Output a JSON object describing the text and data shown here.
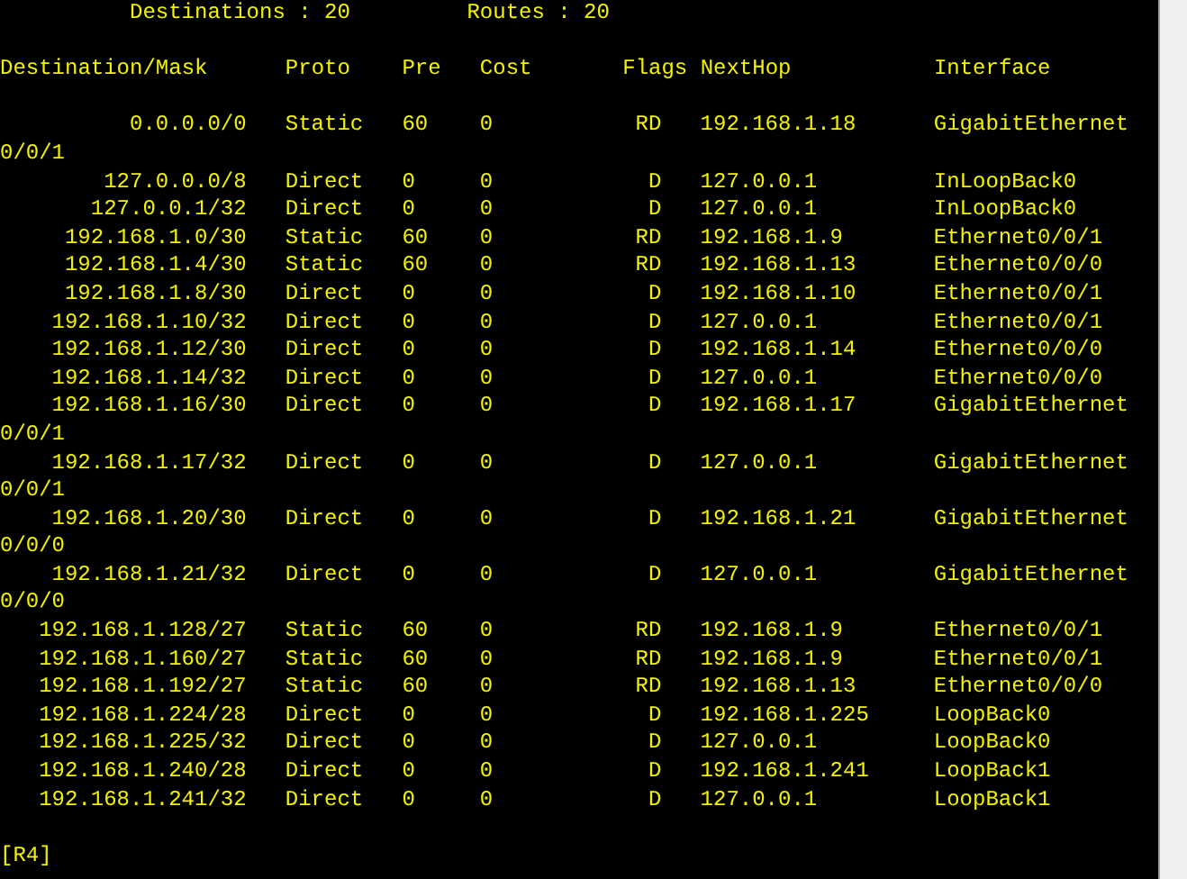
{
  "summary": {
    "destinations_label": "Destinations : 20",
    "routes_label": "Routes : 20"
  },
  "columns": [
    "Destination/Mask",
    "Proto",
    "Pre",
    "Cost",
    "Flags",
    "NextHop",
    "Interface"
  ],
  "routes": [
    {
      "destination": "0.0.0.0/0",
      "proto": "Static",
      "pre": "60",
      "cost": "0",
      "flags": "RD",
      "nexthop": "192.168.1.18",
      "interface": "GigabitEthernet",
      "interface_wrap": "0/0/1"
    },
    {
      "destination": "127.0.0.0/8",
      "proto": "Direct",
      "pre": "0",
      "cost": "0",
      "flags": "D",
      "nexthop": "127.0.0.1",
      "interface": "InLoopBack0"
    },
    {
      "destination": "127.0.0.1/32",
      "proto": "Direct",
      "pre": "0",
      "cost": "0",
      "flags": "D",
      "nexthop": "127.0.0.1",
      "interface": "InLoopBack0"
    },
    {
      "destination": "192.168.1.0/30",
      "proto": "Static",
      "pre": "60",
      "cost": "0",
      "flags": "RD",
      "nexthop": "192.168.1.9",
      "interface": "Ethernet0/0/1"
    },
    {
      "destination": "192.168.1.4/30",
      "proto": "Static",
      "pre": "60",
      "cost": "0",
      "flags": "RD",
      "nexthop": "192.168.1.13",
      "interface": "Ethernet0/0/0"
    },
    {
      "destination": "192.168.1.8/30",
      "proto": "Direct",
      "pre": "0",
      "cost": "0",
      "flags": "D",
      "nexthop": "192.168.1.10",
      "interface": "Ethernet0/0/1"
    },
    {
      "destination": "192.168.1.10/32",
      "proto": "Direct",
      "pre": "0",
      "cost": "0",
      "flags": "D",
      "nexthop": "127.0.0.1",
      "interface": "Ethernet0/0/1"
    },
    {
      "destination": "192.168.1.12/30",
      "proto": "Direct",
      "pre": "0",
      "cost": "0",
      "flags": "D",
      "nexthop": "192.168.1.14",
      "interface": "Ethernet0/0/0"
    },
    {
      "destination": "192.168.1.14/32",
      "proto": "Direct",
      "pre": "0",
      "cost": "0",
      "flags": "D",
      "nexthop": "127.0.0.1",
      "interface": "Ethernet0/0/0"
    },
    {
      "destination": "192.168.1.16/30",
      "proto": "Direct",
      "pre": "0",
      "cost": "0",
      "flags": "D",
      "nexthop": "192.168.1.17",
      "interface": "GigabitEthernet",
      "interface_wrap": "0/0/1"
    },
    {
      "destination": "192.168.1.17/32",
      "proto": "Direct",
      "pre": "0",
      "cost": "0",
      "flags": "D",
      "nexthop": "127.0.0.1",
      "interface": "GigabitEthernet",
      "interface_wrap": "0/0/1"
    },
    {
      "destination": "192.168.1.20/30",
      "proto": "Direct",
      "pre": "0",
      "cost": "0",
      "flags": "D",
      "nexthop": "192.168.1.21",
      "interface": "GigabitEthernet",
      "interface_wrap": "0/0/0"
    },
    {
      "destination": "192.168.1.21/32",
      "proto": "Direct",
      "pre": "0",
      "cost": "0",
      "flags": "D",
      "nexthop": "127.0.0.1",
      "interface": "GigabitEthernet",
      "interface_wrap": "0/0/0"
    },
    {
      "destination": "192.168.1.128/27",
      "proto": "Static",
      "pre": "60",
      "cost": "0",
      "flags": "RD",
      "nexthop": "192.168.1.9",
      "interface": "Ethernet0/0/1"
    },
    {
      "destination": "192.168.1.160/27",
      "proto": "Static",
      "pre": "60",
      "cost": "0",
      "flags": "RD",
      "nexthop": "192.168.1.9",
      "interface": "Ethernet0/0/1"
    },
    {
      "destination": "192.168.1.192/27",
      "proto": "Static",
      "pre": "60",
      "cost": "0",
      "flags": "RD",
      "nexthop": "192.168.1.13",
      "interface": "Ethernet0/0/0"
    },
    {
      "destination": "192.168.1.224/28",
      "proto": "Direct",
      "pre": "0",
      "cost": "0",
      "flags": "D",
      "nexthop": "192.168.1.225",
      "interface": "LoopBack0"
    },
    {
      "destination": "192.168.1.225/32",
      "proto": "Direct",
      "pre": "0",
      "cost": "0",
      "flags": "D",
      "nexthop": "127.0.0.1",
      "interface": "LoopBack0"
    },
    {
      "destination": "192.168.1.240/28",
      "proto": "Direct",
      "pre": "0",
      "cost": "0",
      "flags": "D",
      "nexthop": "192.168.1.241",
      "interface": "LoopBack1"
    },
    {
      "destination": "192.168.1.241/32",
      "proto": "Direct",
      "pre": "0",
      "cost": "0",
      "flags": "D",
      "nexthop": "127.0.0.1",
      "interface": "LoopBack1"
    }
  ],
  "prompt": "[R4]"
}
